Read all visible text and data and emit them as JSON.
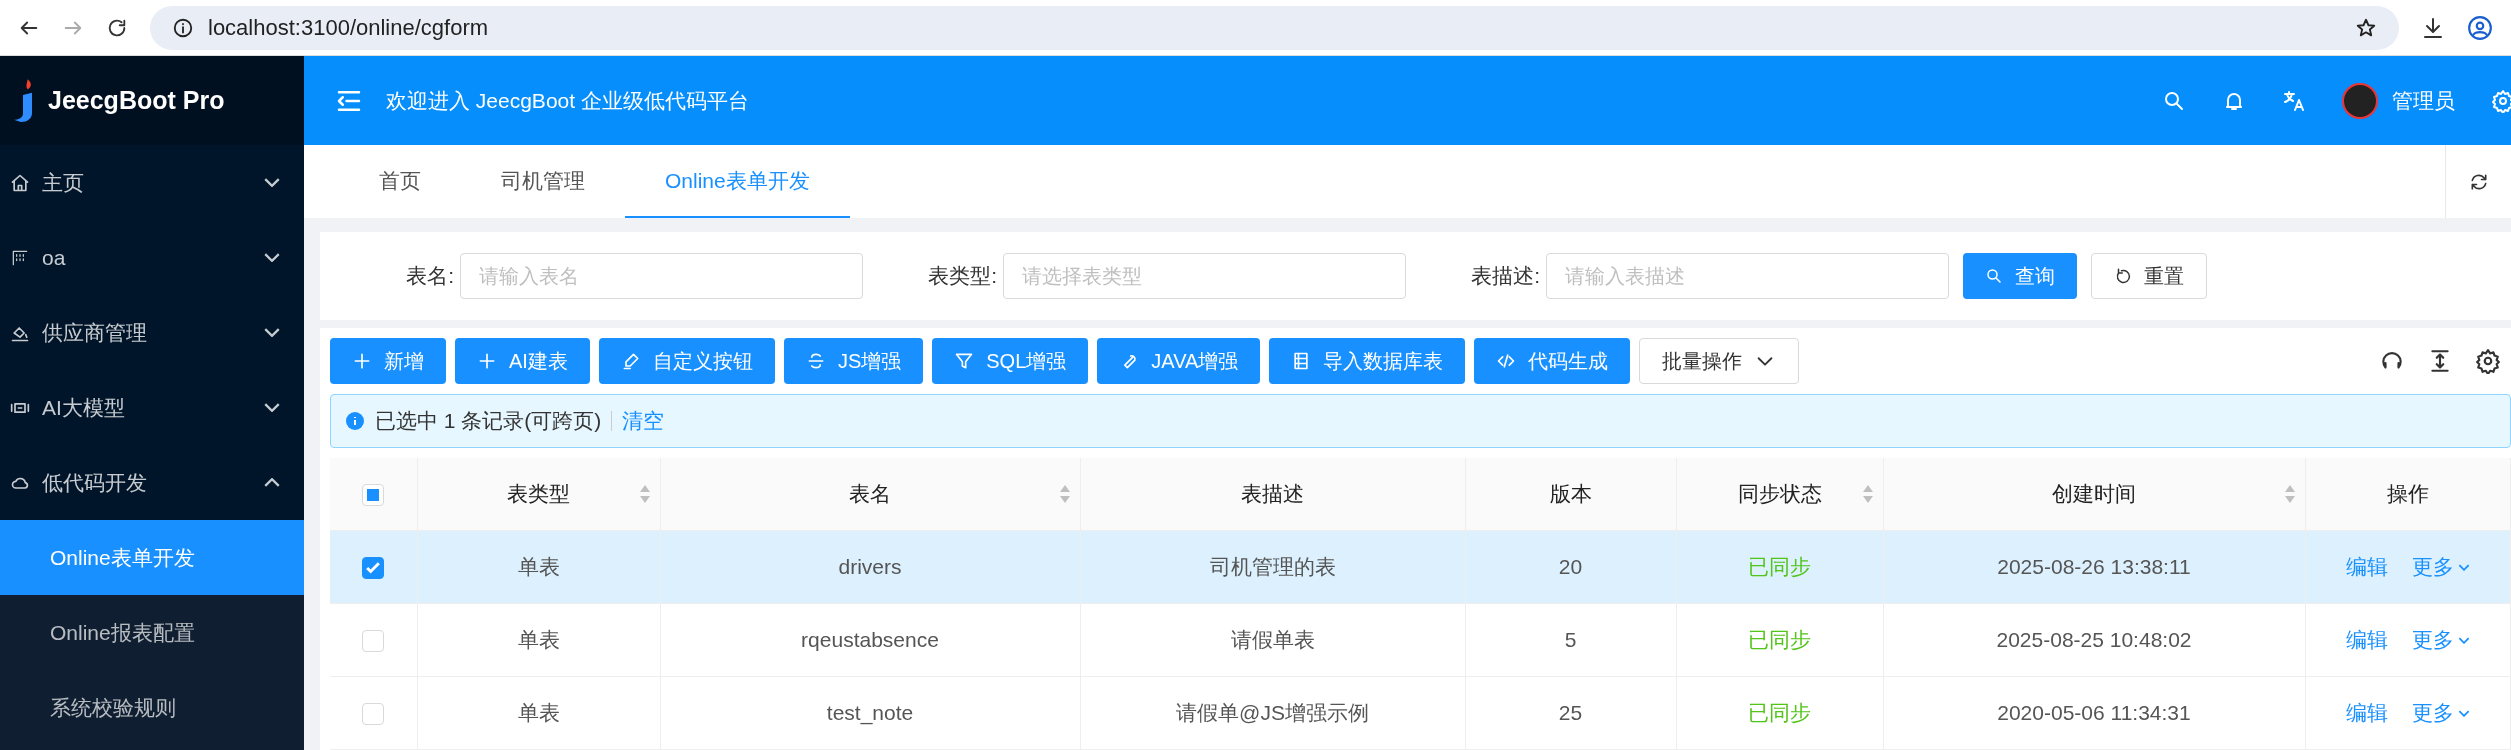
{
  "browser": {
    "url": "localhost:3100/online/cgform"
  },
  "brand": {
    "name": "JeecgBoot Pro"
  },
  "sidebar": {
    "items": [
      {
        "label": "主页",
        "expanded": false
      },
      {
        "label": "oa",
        "expanded": false
      },
      {
        "label": "供应商管理",
        "expanded": false
      },
      {
        "label": "AI大模型",
        "expanded": false
      },
      {
        "label": "低代码开发",
        "expanded": true,
        "children": [
          {
            "label": "Online表单开发",
            "selected": true
          },
          {
            "label": "Online报表配置",
            "selected": false
          },
          {
            "label": "系统校验规则",
            "selected": false
          }
        ]
      }
    ]
  },
  "header": {
    "title": "欢迎进入 JeecgBoot 企业级低代码平台",
    "user": "管理员"
  },
  "tabs": [
    {
      "label": "首页",
      "selected": false
    },
    {
      "label": "司机管理",
      "selected": false
    },
    {
      "label": "Online表单开发",
      "selected": true
    }
  ],
  "search": {
    "fields": [
      {
        "label": "表名:",
        "placeholder": "请输入表名"
      },
      {
        "label": "表类型:",
        "placeholder": "请选择表类型"
      },
      {
        "label": "表描述:",
        "placeholder": "请输入表描述"
      }
    ],
    "buttons": [
      {
        "label": "查询",
        "kind": "primary"
      },
      {
        "label": "重置",
        "kind": "default"
      }
    ]
  },
  "toolbar": {
    "buttons": [
      {
        "label": "新增"
      },
      {
        "label": "AI建表"
      },
      {
        "label": "自定义按钮"
      },
      {
        "label": "JS增强"
      },
      {
        "label": "SQL增强"
      },
      {
        "label": "JAVA增强"
      },
      {
        "label": "导入数据库表"
      },
      {
        "label": "代码生成"
      }
    ],
    "batch": "批量操作"
  },
  "alert": {
    "text": "已选中 1 条记录(可跨页)",
    "action": "清空"
  },
  "table": {
    "indeterminate": true,
    "columns": [
      {
        "label": "表类型",
        "sortable": true
      },
      {
        "label": "表名",
        "sortable": true
      },
      {
        "label": "表描述",
        "sortable": false
      },
      {
        "label": "版本",
        "sortable": false
      },
      {
        "label": "同步状态",
        "sortable": true
      },
      {
        "label": "创建时间",
        "sortable": true
      },
      {
        "label": "操作",
        "sortable": false
      }
    ],
    "rows": [
      {
        "selected": true,
        "type": "单表",
        "name": "drivers",
        "desc": "司机管理的表",
        "version": "20",
        "sync": "已同步",
        "created": "2025-08-26 13:38:11",
        "edit": "编辑",
        "more": "更多"
      },
      {
        "selected": false,
        "type": "单表",
        "name": "rqeustabsence",
        "desc": "请假单表",
        "version": "5",
        "sync": "已同步",
        "created": "2025-08-25 10:48:02",
        "edit": "编辑",
        "more": "更多"
      },
      {
        "selected": false,
        "type": "单表",
        "name": "test_note",
        "desc": "请假单@JS增强示例",
        "version": "25",
        "sync": "已同步",
        "created": "2020-05-06 11:34:31",
        "edit": "编辑",
        "more": "更多"
      }
    ]
  }
}
